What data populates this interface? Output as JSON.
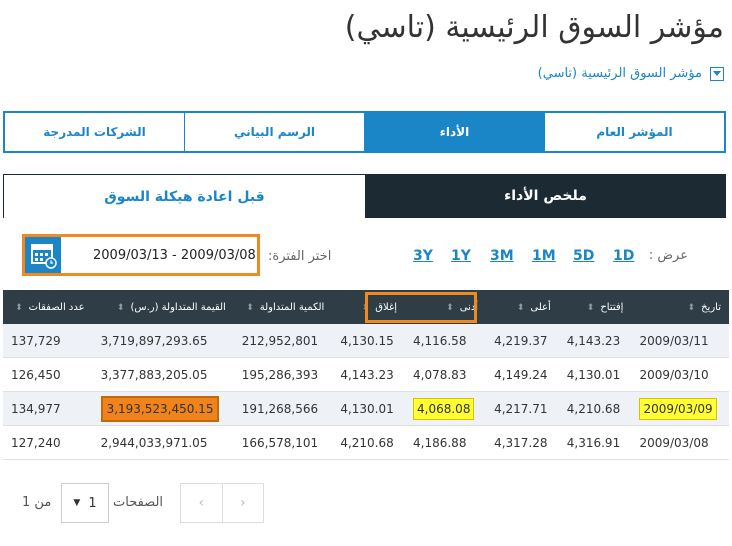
{
  "page_title": "مؤشر السوق الرئيسية (تاسي)",
  "sub_nav_label": "مؤشر السوق الرئيسية (تاسي)",
  "top_tabs": [
    "المؤشر العام",
    "الأداء",
    "الرسم البياني",
    "الشركات المدرجة"
  ],
  "sub_tabs": [
    "ملخص الأداء",
    "قبل اعادة هيكلة السوق"
  ],
  "show_label": "عرض :",
  "periods": [
    "1D",
    "5D",
    "1M",
    "3M",
    "1Y",
    "3Y"
  ],
  "period_label": "اختر الفترة:",
  "date_range": "2009/03/13 - 2009/03/08",
  "columns": [
    "تاريخ",
    "إفتتاح",
    "أعلى",
    "أدنى",
    "إغلاق",
    "الكمية المتداولة",
    "القيمة المتداولة (ر.س)",
    "عدد الصفقات"
  ],
  "rows": [
    [
      "2009/03/11",
      "4,143.23",
      "4,219.37",
      "4,116.58",
      "4,130.15",
      "212,952,801",
      "3,719,897,293.65",
      "137,729"
    ],
    [
      "2009/03/10",
      "4,130.01",
      "4,149.24",
      "4,078.83",
      "4,143.23",
      "195,286,393",
      "3,377,883,205.05",
      "126,450"
    ],
    [
      "2009/03/09",
      "4,210.68",
      "4,217.71",
      "4,068.08",
      "4,130.01",
      "191,268,566",
      "3,193,523,450.15",
      "134,977"
    ],
    [
      "2009/03/08",
      "4,316.91",
      "4,317.28",
      "4,186.88",
      "4,210.68",
      "166,578,101",
      "2,944,033,971.05",
      "127,240"
    ]
  ],
  "pagination": {
    "pages_label": "الصفحات",
    "current": "1",
    "of_label": "من",
    "total": "1"
  },
  "colors": {
    "accent": "#1a86c8",
    "dark": "#1b2a33",
    "highlight_yellow": "#ffff33",
    "highlight_orange": "#f0841a"
  }
}
